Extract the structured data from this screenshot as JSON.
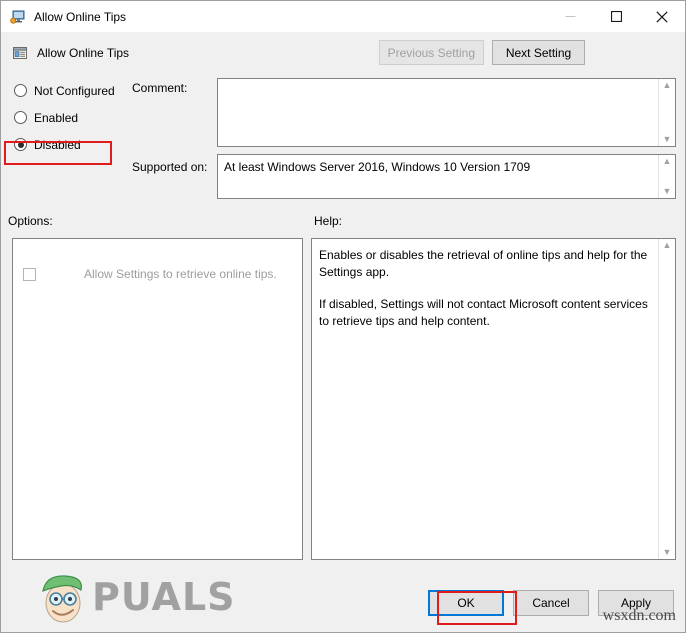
{
  "window": {
    "title": "Allow Online Tips",
    "title_icon": "monitor-policy-icon",
    "minimize_label": "Minimize",
    "maximize_label": "Maximize",
    "close_label": "Close"
  },
  "header": {
    "setting_name": "Allow Online Tips",
    "setting_icon": "policy-setting-icon",
    "previous_setting_label": "Previous Setting",
    "next_setting_label": "Next Setting"
  },
  "state_options": {
    "items": [
      {
        "label": "Not Configured",
        "selected": false
      },
      {
        "label": "Enabled",
        "selected": false
      },
      {
        "label": "Disabled",
        "selected": true
      }
    ]
  },
  "comment": {
    "label": "Comment:",
    "value": "",
    "placeholder": ""
  },
  "supported_on": {
    "label": "Supported on:",
    "value": "At least Windows Server 2016, Windows 10 Version 1709"
  },
  "options": {
    "label": "Options:",
    "checkbox_label": "Allow Settings to retrieve online tips.",
    "checkbox_checked": false,
    "checkbox_enabled": false
  },
  "help": {
    "label": "Help:",
    "paragraphs": [
      "Enables or disables the retrieval of online tips and help for the Settings app.",
      "If disabled, Settings will not contact Microsoft content services to retrieve tips and help content."
    ]
  },
  "footer": {
    "ok_label": "OK",
    "cancel_label": "Cancel",
    "apply_label": "Apply"
  },
  "annotations": {
    "highlight_color": "#e01b1b",
    "focus_color": "#0078d7",
    "disabled_highlight_target": "Disabled",
    "ok_highlight_target": "OK"
  },
  "watermarks": {
    "brand": "PUALS",
    "site": "wsxdn.com"
  }
}
